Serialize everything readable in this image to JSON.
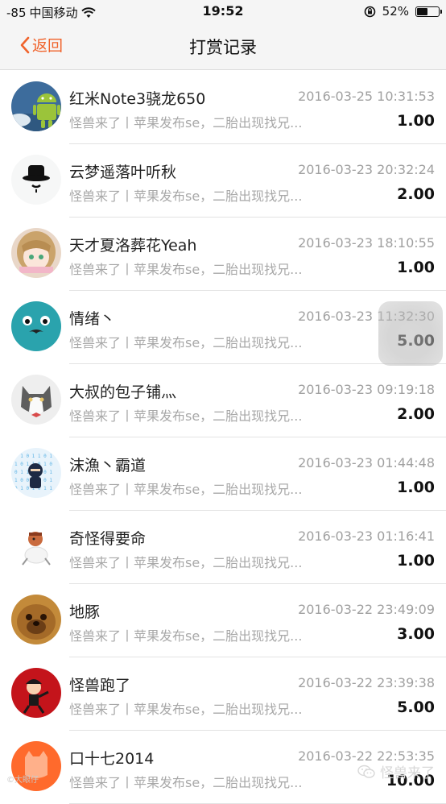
{
  "status_bar": {
    "signal": "-85",
    "carrier": "中国移动",
    "time": "19:52",
    "battery": "52%",
    "battery_level": 0.52
  },
  "nav": {
    "back_label": "返回",
    "title": "打赏记录"
  },
  "records": [
    {
      "name": "红米Note3骁龙650",
      "time": "2016-03-25 10:31:53",
      "article": "怪兽来了丨苹果发布se，二胎出现找兄...",
      "amount": "1.00",
      "avatar": "android-avatar"
    },
    {
      "name": "云梦遥落叶听秋",
      "time": "2016-03-23 20:32:24",
      "article": "怪兽来了丨苹果发布se，二胎出现找兄...",
      "amount": "2.00",
      "avatar": "top-hat-avatar"
    },
    {
      "name": "天才夏洛葬花Yeah",
      "time": "2016-03-23 18:10:55",
      "article": "怪兽来了丨苹果发布se，二胎出现找兄...",
      "amount": "1.00",
      "avatar": "anime-girl-avatar"
    },
    {
      "name": "情绪丶",
      "time": "2016-03-23 11:32:30",
      "article": "怪兽来了丨苹果发布se，二胎出现找兄...",
      "amount": "5.00",
      "avatar": "teal-face-avatar"
    },
    {
      "name": "大叔的包子铺灬",
      "time": "2016-03-23 09:19:18",
      "article": "怪兽来了丨苹果发布se，二胎出现找兄...",
      "amount": "2.00",
      "avatar": "cat-avatar"
    },
    {
      "name": "沫漁丶霸道",
      "time": "2016-03-23 01:44:48",
      "article": "怪兽来了丨苹果发布se，二胎出现找兄...",
      "amount": "1.00",
      "avatar": "ninja-avatar"
    },
    {
      "name": "奇怪得要命",
      "time": "2016-03-23 01:16:41",
      "article": "怪兽来了丨苹果发布se，二胎出现找兄...",
      "amount": "1.00",
      "avatar": "cartoon-dog-avatar"
    },
    {
      "name": "地豚",
      "time": "2016-03-22 23:49:09",
      "article": "怪兽来了丨苹果发布se，二胎出现找兄...",
      "amount": "3.00",
      "avatar": "dog-photo-avatar"
    },
    {
      "name": "怪兽跑了",
      "time": "2016-03-22 23:39:38",
      "article": "怪兽来了丨苹果发布se，二胎出现找兄...",
      "amount": "5.00",
      "avatar": "red-cartoon-avatar"
    },
    {
      "name": "口十七2014",
      "time": "2016-03-22 22:53:35",
      "article": "怪兽来了丨苹果发布se，二胎出现找兄...",
      "amount": "10.00",
      "avatar": "orange-cat-avatar"
    }
  ],
  "watermark": {
    "left": "©大眼仔",
    "right": "怪兽来了"
  }
}
